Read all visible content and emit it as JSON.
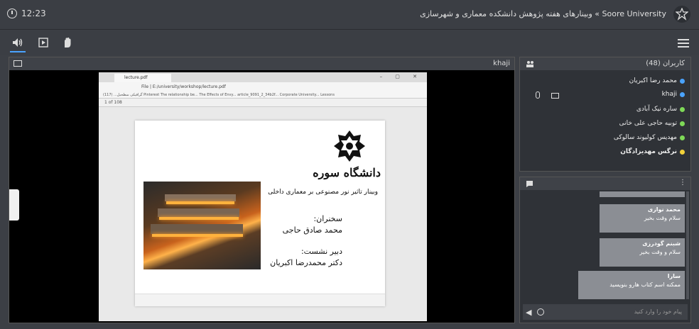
{
  "header": {
    "time": "12:23",
    "title": "Soore University » وبینارهای هفته پژوهش دانشکده معماری و شهرسازی"
  },
  "toolbar": {
    "icons": [
      "speaker-icon",
      "share-screen-icon",
      "raise-hand-icon",
      "menu-icon"
    ],
    "accent": "#4aa3ff"
  },
  "video": {
    "presenter_label": "khaji",
    "browser": {
      "tab_title": "lecture.pdf",
      "address": "File | E:/university/workshop/lecture.pdf",
      "bookmarks": "گرافیکی سطحبل...   (117) Pinterest   The relationship be...   The Effects of Envy...   article_9091_2_34b2f...   Corporate University...   Lessons",
      "page_indicator": "1 of 108"
    },
    "slide": {
      "university": "دانشگاه سوره",
      "webinar_title": "وبینار تاثیر نور مصنوعی بر معماری داخلی",
      "speakers_label": "سخنران:",
      "speaker_name": "محمد صادق حاجی",
      "secretary_label": "دبیر نشست:",
      "secretary_name": "دکتر محمدرضا اکبریان"
    }
  },
  "users": {
    "title": "کاربران (48)",
    "list": [
      {
        "name": "محمد رضا اکبریان",
        "color": "#4aa3ff"
      },
      {
        "name": "khaji",
        "color": "#4aa3ff"
      },
      {
        "name": "ساره نیک آبادی",
        "color": "#7ed957"
      },
      {
        "name": "توبیه حاجی علی خانی",
        "color": "#7ed957"
      },
      {
        "name": "مهدیس کولیوند سالوکی",
        "color": "#7ed957"
      },
      {
        "name": "نرگس مهدیزادگان",
        "color": "#f2d13a"
      }
    ]
  },
  "chat": {
    "messages": [
      {
        "who": "محمد نوازی",
        "text": "سلام وقت بخیر"
      },
      {
        "who": "شبنم گودرزی",
        "text": "سلام و وقت بخیر"
      },
      {
        "who": "سارا",
        "text": "ممکنه اسم کتاب هارو بنویسید"
      }
    ],
    "input_placeholder": "پیام خود را وارد کنید"
  }
}
